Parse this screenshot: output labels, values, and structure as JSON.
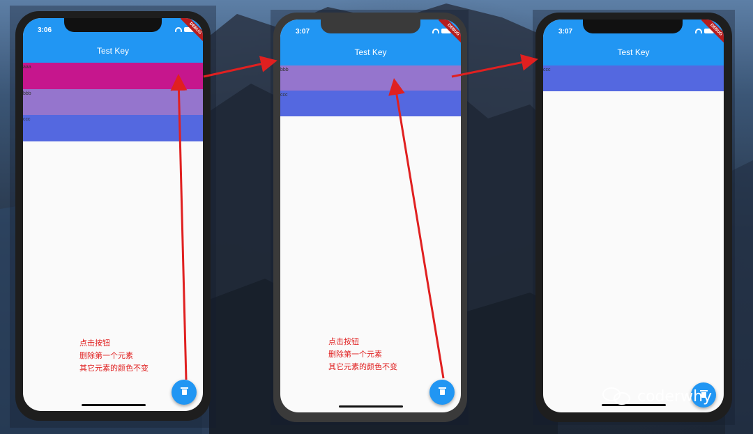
{
  "phones": [
    {
      "time": "3:06",
      "title": "Test Key",
      "debug": "DEBUG",
      "items": [
        {
          "label": "aaa",
          "color": "#c6168d"
        },
        {
          "label": "bbb",
          "color": "#9575cd"
        },
        {
          "label": "ccc",
          "color": "#5468e0"
        }
      ]
    },
    {
      "time": "3:07",
      "title": "Test Key",
      "debug": "DEBUG",
      "items": [
        {
          "label": "bbb",
          "color": "#9575cd"
        },
        {
          "label": "ccc",
          "color": "#5468e0"
        }
      ]
    },
    {
      "time": "3:07",
      "title": "Test Key",
      "debug": "DEBUG",
      "items": [
        {
          "label": "ccc",
          "color": "#5468e0"
        }
      ]
    }
  ],
  "annotation": {
    "line1": "点击按钮",
    "line2": "删除第一个元素",
    "line3": "其它元素的颜色不变"
  },
  "fab_icon": "delete-icon",
  "accent_color": "#2196f3",
  "annotation_color": "#e02020",
  "watermark": "coderwhy"
}
